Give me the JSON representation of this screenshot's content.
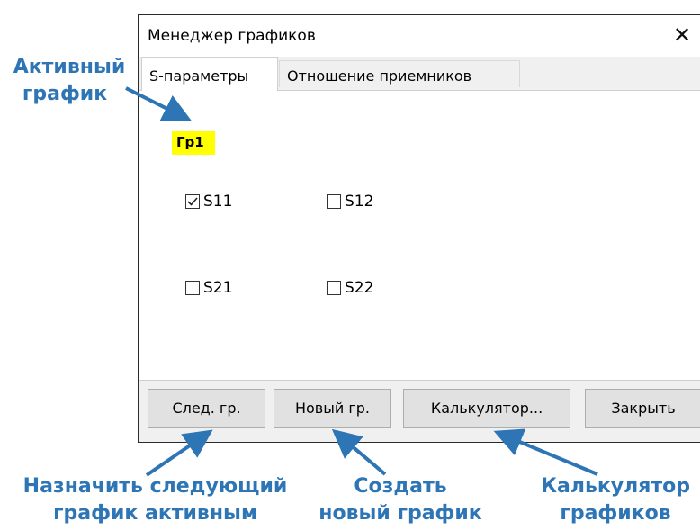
{
  "window": {
    "title": "Менеджер графиков",
    "close_glyph": "✕"
  },
  "tabs": [
    {
      "label": "S-параметры",
      "active": true
    },
    {
      "label": "Отношение приемников",
      "active": false
    }
  ],
  "panel": {
    "active_graph": "Гр1",
    "checkboxes": [
      {
        "label": "S11",
        "checked": true
      },
      {
        "label": "S12",
        "checked": false
      },
      {
        "label": "S21",
        "checked": false
      },
      {
        "label": "S22",
        "checked": false
      }
    ]
  },
  "buttons": {
    "next_graph": "След. гр.",
    "new_graph": "Новый гр.",
    "calculator": "Калькулятор...",
    "close": "Закрыть"
  },
  "annotations": {
    "active_graph_line1": "Активный",
    "active_graph_line2": "график",
    "next_line1": "Назначить следующий",
    "next_line2": "график активным",
    "create_line1": "Создать",
    "create_line2": "новый график",
    "calc_line1": "Калькулятор",
    "calc_line2": "графиков"
  },
  "colors": {
    "annotation": "#2e75b6",
    "highlight": "#ffff00"
  }
}
